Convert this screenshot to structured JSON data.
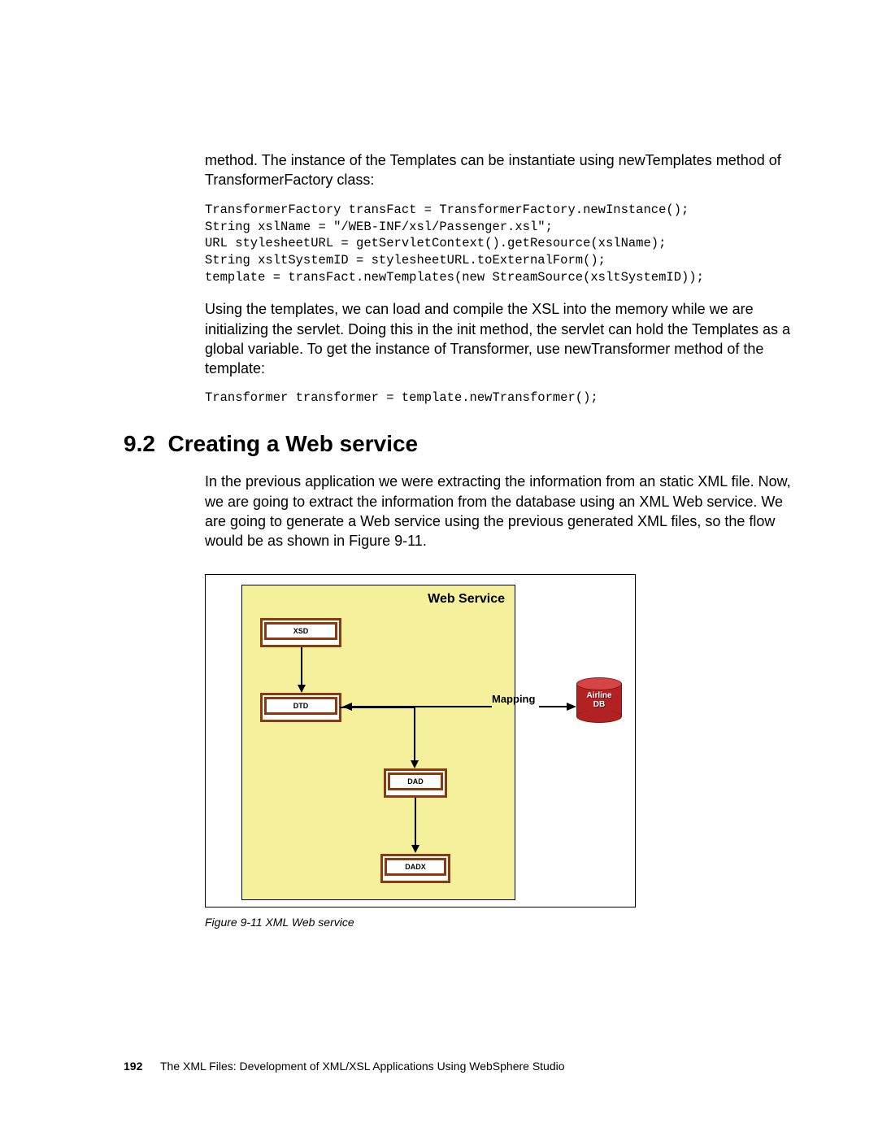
{
  "para1": "method. The instance of the Templates can be instantiate using newTemplates method of TransformerFactory class:",
  "code1": "TransformerFactory transFact = TransformerFactory.newInstance();\nString xslName = \"/WEB-INF/xsl/Passenger.xsl\";\nURL stylesheetURL = getServletContext().getResource(xslName);\nString xsltSystemID = stylesheetURL.toExternalForm();\ntemplate = transFact.newTemplates(new StreamSource(xsltSystemID));",
  "para2": "Using the templates, we can load and compile the XSL into the memory while we are initializing the servlet. Doing this in the init method, the servlet can hold the Templates as a global variable. To get the instance of Transformer, use newTransformer method of the template:",
  "code2": "Transformer transformer = template.newTransformer();",
  "section_number": "9.2",
  "section_title": "Creating a Web service",
  "para3": "In the previous application we were extracting the information from an static XML file. Now, we are going to extract the information from the database using an XML Web service. We are going to generate a Web service using the previous generated XML files, so the flow would be as shown in Figure 9-11.",
  "figure": {
    "ws_title": "Web Service",
    "xsd": "XSD",
    "dtd": "DTD",
    "dad": "DAD",
    "dadx": "DADX",
    "mapping": "Mapping",
    "db_line1": "Airline",
    "db_line2": "DB",
    "caption": "Figure 9-11   XML Web service"
  },
  "footer": {
    "page": "192",
    "title": "The XML Files:   Development of XML/XSL Applications Using WebSphere Studio"
  }
}
